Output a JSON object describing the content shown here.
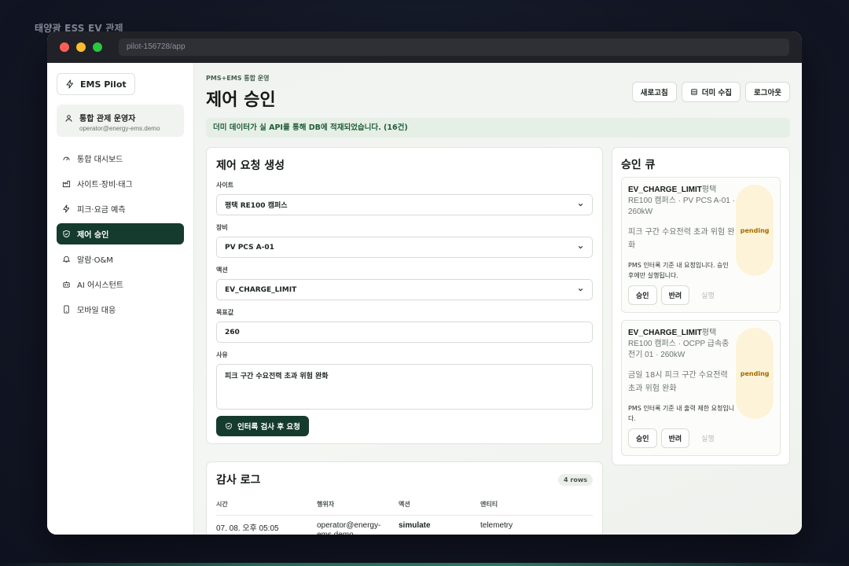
{
  "page_caption": "태양광 ESS EV 관제",
  "window": {
    "url": "pilot-156728/app"
  },
  "sidebar": {
    "brand": "EMS Pilot",
    "user": {
      "name": "통합 관제 운영자",
      "email": "operator@energy-ems.demo"
    },
    "items": [
      {
        "label": "통합 대시보드",
        "icon": "gauge-icon",
        "active": false
      },
      {
        "label": "사이트·장비·태그",
        "icon": "factory-icon",
        "active": false
      },
      {
        "label": "피크·요금 예측",
        "icon": "bolt-icon",
        "active": false
      },
      {
        "label": "제어 승인",
        "icon": "shield-check-icon",
        "active": true
      },
      {
        "label": "알람·O&M",
        "icon": "bell-icon",
        "active": false
      },
      {
        "label": "AI 어시스턴트",
        "icon": "bot-icon",
        "active": false
      },
      {
        "label": "모바일 대응",
        "icon": "phone-icon",
        "active": false
      }
    ]
  },
  "header": {
    "eyebrow": "PMS+EMS 통합 운영",
    "title": "제어 승인",
    "refresh": "새로고침",
    "dummy_collect": "더미 수집",
    "logout": "로그아웃"
  },
  "notice": "더미 데이터가 실 API를 통해 DB에 적재되었습니다. (16건)",
  "form": {
    "title": "제어 요청 생성",
    "site_label": "사이트",
    "site_value": "평택 RE100 캠퍼스",
    "device_label": "장비",
    "device_value": "PV PCS A-01",
    "action_label": "액션",
    "action_value": "EV_CHARGE_LIMIT",
    "target_label": "목표값",
    "target_value": "260",
    "reason_label": "사유",
    "reason_value": "피크 구간 수요전력 초과 위험 완화",
    "submit": "인터록 검사 후 요청"
  },
  "audit": {
    "title": "감사 로그",
    "rows_badge": "4 rows",
    "columns": [
      "시간",
      "행위자",
      "액션",
      "엔티티"
    ],
    "rows": [
      {
        "time": "07. 08. 오후 05:05",
        "actor": "operator@energy-ems.demo",
        "action": "simulate",
        "entity": "telemetry"
      }
    ]
  },
  "queue": {
    "title": "승인 큐",
    "items": [
      {
        "action": "EV_CHARGE_LIMIT",
        "site_prefix": "평택",
        "meta": "RE100 캠퍼스 · PV PCS A-01 · 260kW",
        "reason": "피크 구간 수요전력 초과 위험 완화",
        "note": "PMS 인터록 기준 내 요청입니다. 승인 후에만 실행됩니다.",
        "status": "pending",
        "approve": "승인",
        "reject": "반려",
        "execute": "실행"
      },
      {
        "action": "EV_CHARGE_LIMIT",
        "site_prefix": "평택",
        "meta": "RE100 캠퍼스 · OCPP 급속충전기 01 · 260kW",
        "reason": "금일 18시 피크 구간 수요전력 초과 위험 완화",
        "note": "PMS 인터록 기준 내 출력 제한 요청입니다.",
        "status": "pending",
        "approve": "승인",
        "reject": "반려",
        "execute": "실행"
      }
    ]
  },
  "colors": {
    "accent": "#153b2e",
    "pending_bg": "#fdf3d8",
    "pending_text": "#a46a00",
    "notice_bg": "#e6efe6"
  }
}
